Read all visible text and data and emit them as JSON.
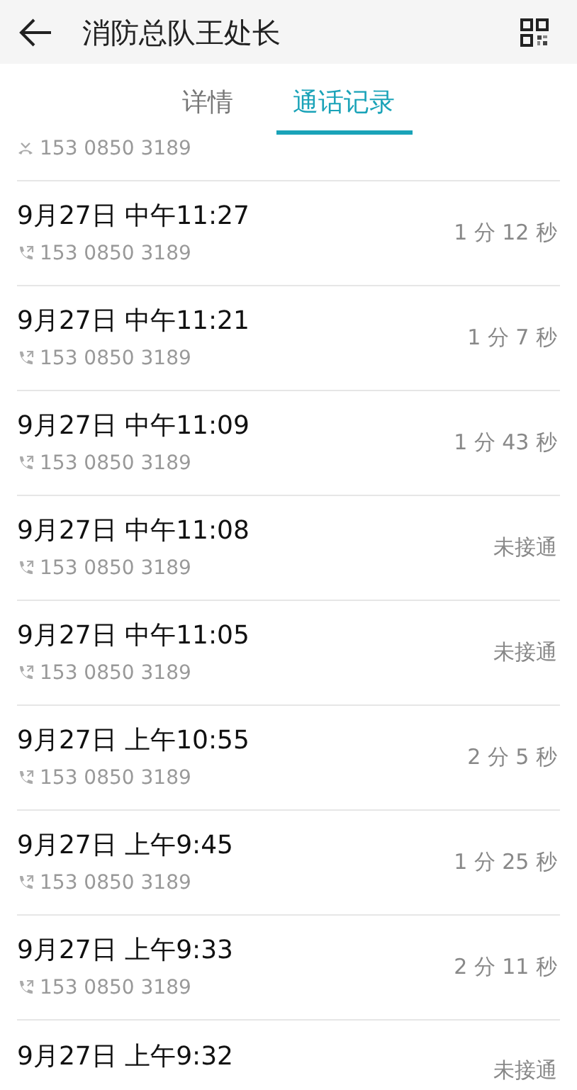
{
  "header": {
    "title": "消防总队王处长"
  },
  "tabs": [
    {
      "label": "详情",
      "selected": false
    },
    {
      "label": "通话记录",
      "selected": true
    }
  ],
  "calls": [
    {
      "kind": "partial",
      "number": "153 0850 3189",
      "missed": true
    },
    {
      "kind": "full",
      "time": "9月27日 中午11:27",
      "number": "153 0850 3189",
      "result": "1 分 12 秒",
      "missed": false
    },
    {
      "kind": "full",
      "time": "9月27日 中午11:21",
      "number": "153 0850 3189",
      "result": "1 分 7 秒",
      "missed": false
    },
    {
      "kind": "full",
      "time": "9月27日 中午11:09",
      "number": "153 0850 3189",
      "result": "1 分 43 秒",
      "missed": false
    },
    {
      "kind": "full",
      "time": "9月27日 中午11:08",
      "number": "153 0850 3189",
      "result": "未接通",
      "missed": false
    },
    {
      "kind": "full",
      "time": "9月27日 中午11:05",
      "number": "153 0850 3189",
      "result": "未接通",
      "missed": false
    },
    {
      "kind": "full",
      "time": "9月27日 上午10:55",
      "number": "153 0850 3189",
      "result": "2 分 5 秒",
      "missed": false
    },
    {
      "kind": "full",
      "time": "9月27日 上午9:45",
      "number": "153 0850 3189",
      "result": "1 分 25 秒",
      "missed": false
    },
    {
      "kind": "full",
      "time": "9月27日 上午9:33",
      "number": "153 0850 3189",
      "result": "2 分 11 秒",
      "missed": false
    },
    {
      "kind": "last",
      "time": "9月27日 上午9:32",
      "result": "未接通"
    }
  ]
}
